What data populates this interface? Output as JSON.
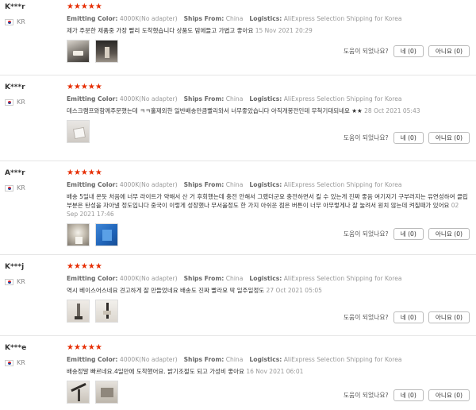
{
  "helpful_question": "도움이 되었나요?",
  "labels": {
    "emitting_color": "Emitting Color:",
    "ships_from": "Ships From:",
    "logistics": "Logistics:"
  },
  "reviews": [
    {
      "username": "K***r",
      "country": "KR",
      "stars": "★★★★★",
      "emitting_color": "4000K(No adapter)",
      "ships_from": "China",
      "logistics": "AliExpress Selection Shipping for Korea",
      "text": "제가 주문한 제품중 가장 빨리 도착했습니다 상품도 맘에들고 가볍고 좋아요",
      "date": "15 Nov 2021 20:29",
      "yes_label": "네 (0)",
      "no_label": "아니요 (0)"
    },
    {
      "username": "K***r",
      "country": "KR",
      "stars": "★★★★★",
      "emitting_color": "4000K(No adapter)",
      "ships_from": "China",
      "logistics": "AliExpress Selection Shipping for Korea",
      "text": "데스크램프와함께주문했는데 ㅋㅋ홀제외한 일반배송만큼빨리와서 너무좋았습니다 아직개봉전인데 무척기대되네요 ★★",
      "date": "28 Oct 2021 05:43",
      "yes_label": "네 (0)",
      "no_label": "아니요 (0)"
    },
    {
      "username": "A***r",
      "country": "KR",
      "stars": "★★★★★",
      "emitting_color": "4000K(No adapter)",
      "ships_from": "China",
      "logistics": "AliExpress Selection Shipping for Korea",
      "text": "배송 5일내 온듯 처음에 너무 라이트가 약해서 산 거 후회했는데 충전 안해서 그랬더군요 충전하면서 킬 수 있는게 진짜 좋음 여기저기 구부러지는 유연성하여 클립 부분은 탄성을 자아낼 정도입니다 중국이 이렇게 성장했나 무서울정도 한 가지 아쉬운 점은 버튼이 너무 아무렇게나 잘 눌려서 원치 않는데 켜질때가 있어요",
      "date": "02 Sep 2021 17:46",
      "yes_label": "네 (0)",
      "no_label": "아니요 (0)"
    },
    {
      "username": "K***j",
      "country": "KR",
      "stars": "★★★★★",
      "emitting_color": "4000K(No adapter)",
      "ships_from": "China",
      "logistics": "AliExpress Selection Shipping for Korea",
      "text": "역시 베이스어스네요 견고하게 잘 만들었네요 배송도 진짜 빨라요 딱 일주일정도",
      "date": "27 Oct 2021 05:05",
      "yes_label": "네 (0)",
      "no_label": "아니요 (0)"
    },
    {
      "username": "K***e",
      "country": "KR",
      "stars": "★★★★★",
      "emitting_color": "4000K(No adapter)",
      "ships_from": "China",
      "logistics": "AliExpress Selection Shipping for Korea",
      "text": "배송정말 빠르네요.4일만에 도착했어요. 밝기조절도 되고 가성비 좋아요",
      "date": "16 Nov 2021 06:01",
      "yes_label": "네 (0)",
      "no_label": "아니요 (0)"
    }
  ]
}
